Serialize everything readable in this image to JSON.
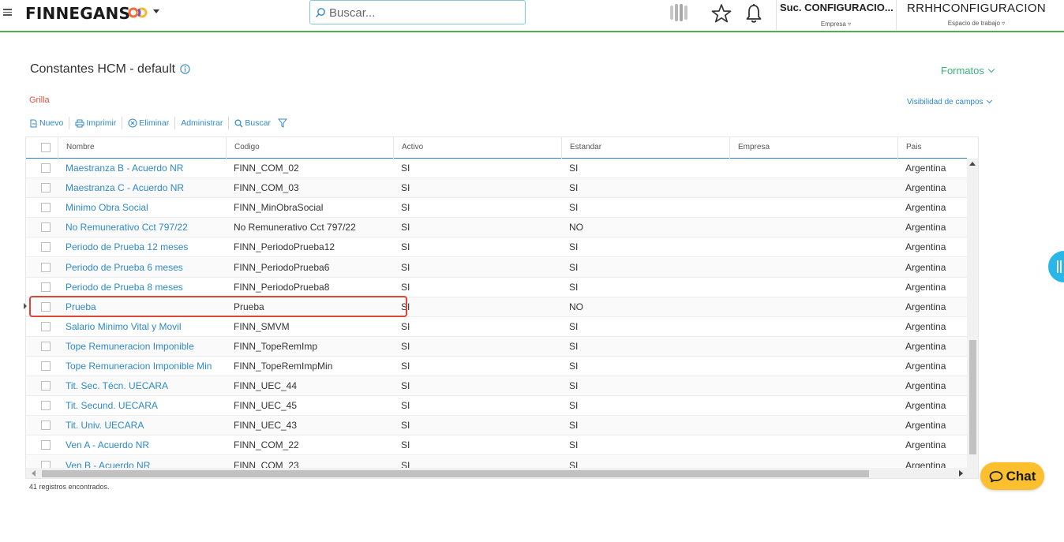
{
  "topbar": {
    "brand": "FINNEGANS",
    "search_placeholder": "Buscar...",
    "empresa": {
      "value": "Suc. CONFIGURACIO...",
      "label": "Empresa"
    },
    "espacio": {
      "value": "RRHHCONFIGURACION",
      "label": "Espacio de trabajo"
    },
    "accent_color": "#4caf50"
  },
  "page": {
    "title": "Constantes HCM - default",
    "formatos": "Formatos",
    "grilla": "Grilla",
    "visibilidad": "Visibilidad de campos"
  },
  "toolbar": {
    "nuevo": "Nuevo",
    "imprimir": "Imprimir",
    "eliminar": "Eliminar",
    "administrar": "Administrar",
    "buscar": "Buscar"
  },
  "grid": {
    "columns": [
      "Nombre",
      "Codigo",
      "Activo",
      "Estandar",
      "Empresa",
      "Pais"
    ],
    "rows": [
      {
        "nombre": "Maestranza B - Acuerdo NR",
        "codigo": "FINN_COM_02",
        "activo": "SI",
        "estandar": "SI",
        "empresa": "",
        "pais": "Argentina"
      },
      {
        "nombre": "Maestranza C - Acuerdo NR",
        "codigo": "FINN_COM_03",
        "activo": "SI",
        "estandar": "SI",
        "empresa": "",
        "pais": "Argentina"
      },
      {
        "nombre": "Minimo Obra Social",
        "codigo": "FINN_MinObraSocial",
        "activo": "SI",
        "estandar": "SI",
        "empresa": "",
        "pais": "Argentina"
      },
      {
        "nombre": "No Remunerativo Cct 797/22",
        "codigo": "No Remunerativo Cct 797/22",
        "activo": "SI",
        "estandar": "NO",
        "empresa": "",
        "pais": "Argentina"
      },
      {
        "nombre": "Periodo de Prueba 12 meses",
        "codigo": "FINN_PeriodoPrueba12",
        "activo": "SI",
        "estandar": "SI",
        "empresa": "",
        "pais": "Argentina"
      },
      {
        "nombre": "Periodo de Prueba 6 meses",
        "codigo": "FINN_PeriodoPrueba6",
        "activo": "SI",
        "estandar": "SI",
        "empresa": "",
        "pais": "Argentina"
      },
      {
        "nombre": "Periodo de Prueba 8 meses",
        "codigo": "FINN_PeriodoPrueba8",
        "activo": "SI",
        "estandar": "SI",
        "empresa": "",
        "pais": "Argentina"
      },
      {
        "nombre": "Prueba",
        "codigo": "Prueba",
        "activo": "SI",
        "estandar": "NO",
        "empresa": "",
        "pais": "Argentina"
      },
      {
        "nombre": "Salario Minimo Vital y Movil",
        "codigo": "FINN_SMVM",
        "activo": "SI",
        "estandar": "SI",
        "empresa": "",
        "pais": "Argentina"
      },
      {
        "nombre": "Tope Remuneracion Imponible",
        "codigo": "FINN_TopeRemImp",
        "activo": "SI",
        "estandar": "SI",
        "empresa": "",
        "pais": "Argentina"
      },
      {
        "nombre": "Tope Remuneracion Imponible Min",
        "codigo": "FINN_TopeRemImpMin",
        "activo": "SI",
        "estandar": "SI",
        "empresa": "",
        "pais": "Argentina"
      },
      {
        "nombre": "Tit. Sec. Técn. UECARA",
        "codigo": "FINN_UEC_44",
        "activo": "SI",
        "estandar": "SI",
        "empresa": "",
        "pais": "Argentina"
      },
      {
        "nombre": "Tit. Secund. UECARA",
        "codigo": "FINN_UEC_45",
        "activo": "SI",
        "estandar": "SI",
        "empresa": "",
        "pais": "Argentina"
      },
      {
        "nombre": "Tit. Univ. UECARA",
        "codigo": "FINN_UEC_43",
        "activo": "SI",
        "estandar": "SI",
        "empresa": "",
        "pais": "Argentina"
      },
      {
        "nombre": "Ven A - Acuerdo NR",
        "codigo": "FINN_COM_22",
        "activo": "SI",
        "estandar": "SI",
        "empresa": "",
        "pais": "Argentina"
      },
      {
        "nombre": "Ven B - Acuerdo NR",
        "codigo": "FINN_COM_23",
        "activo": "SI",
        "estandar": "SI",
        "empresa": "",
        "pais": "Argentina"
      }
    ],
    "count_text": "41 registros encontrados."
  },
  "chat": {
    "label": "Chat"
  },
  "colors": {
    "link": "#2f89c8",
    "formatos": "#3ab17a",
    "grilla": "#e0533f",
    "highlight": "#d9473b",
    "chat": "#fcc02e"
  }
}
